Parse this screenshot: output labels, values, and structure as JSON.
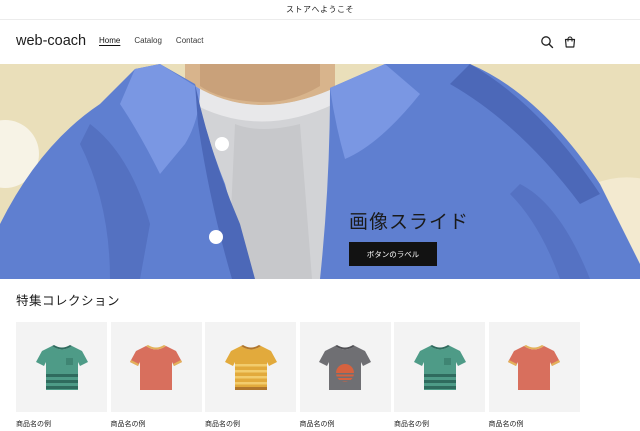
{
  "announcement": {
    "text": "ストアへようこそ"
  },
  "header": {
    "logo": "web-coach",
    "nav": [
      {
        "label": "Home",
        "active": true
      },
      {
        "label": "Catalog",
        "active": false
      },
      {
        "label": "Contact",
        "active": false
      }
    ],
    "icons": [
      "search-icon",
      "cart-icon"
    ]
  },
  "hero": {
    "title": "画像スライド",
    "button_label": "ボタンのラベル",
    "colors": {
      "background": "#e9dfbd",
      "jacket": "#5c7fcf",
      "shirt": "#d3d4d7",
      "skin": "#d8b48c"
    }
  },
  "collection": {
    "title": "特集コレクション",
    "products": [
      {
        "name": "商品名の例",
        "shirt_color": "#4e9b87",
        "stripe_color": "#2f6b5e",
        "icon": "tshirt-green-icon"
      },
      {
        "name": "商品名の例",
        "shirt_color": "#d86f5d",
        "stripe_color": "#e3b15a",
        "icon": "tshirt-red-icon"
      },
      {
        "name": "商品名の例",
        "shirt_color": "#e2aa3c",
        "stripe_color": "#b0762c",
        "icon": "tshirt-yellow-icon"
      },
      {
        "name": "商品名の例",
        "shirt_color": "#6f6f73",
        "stripe_color": "#d6623f",
        "icon": "tshirt-gray-icon"
      },
      {
        "name": "商品名の例",
        "shirt_color": "#4e9b87",
        "stripe_color": "#2f6b5e",
        "icon": "tshirt-green-icon"
      },
      {
        "name": "商品名の例",
        "shirt_color": "#d86f5d",
        "stripe_color": "#e3b15a",
        "icon": "tshirt-red-icon"
      }
    ]
  }
}
